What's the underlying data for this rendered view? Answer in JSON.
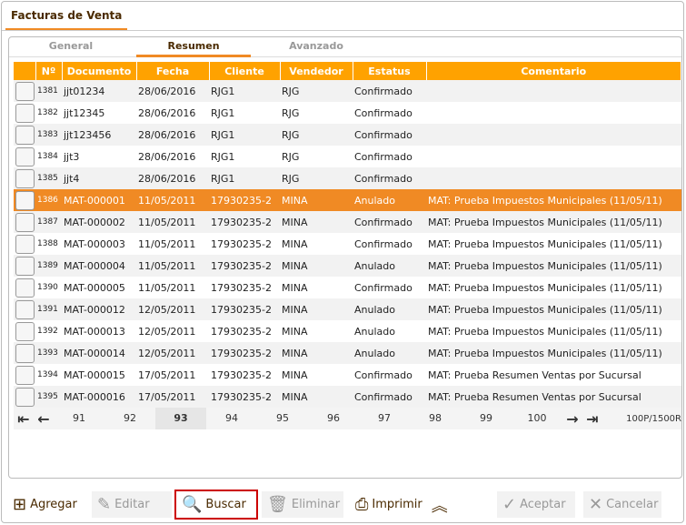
{
  "window": {
    "title": "Facturas de Venta"
  },
  "tabs": [
    "General",
    "Resumen",
    "Avanzado"
  ],
  "columns": [
    "Nº",
    "Documento",
    "Fecha",
    "Cliente",
    "Vendedor",
    "Estatus",
    "Comentario"
  ],
  "rows": [
    [
      "1381",
      "jjt01234",
      "28/06/2016",
      "RJG1",
      "RJG",
      "Confirmado",
      ""
    ],
    [
      "1382",
      "jjt12345",
      "28/06/2016",
      "RJG1",
      "RJG",
      "Confirmado",
      ""
    ],
    [
      "1383",
      "jjt123456",
      "28/06/2016",
      "RJG1",
      "RJG",
      "Confirmado",
      ""
    ],
    [
      "1384",
      "jjt3",
      "28/06/2016",
      "RJG1",
      "RJG",
      "Confirmado",
      ""
    ],
    [
      "1385",
      "jjt4",
      "28/06/2016",
      "RJG1",
      "RJG",
      "Confirmado",
      ""
    ],
    [
      "1386",
      "MAT-000001",
      "11/05/2011",
      "17930235-2",
      "MINA",
      "Anulado",
      "MAT: Prueba Impuestos Municipales (11/05/11)"
    ],
    [
      "1387",
      "MAT-000002",
      "11/05/2011",
      "17930235-2",
      "MINA",
      "Confirmado",
      "MAT: Prueba Impuestos Municipales (11/05/11)"
    ],
    [
      "1388",
      "MAT-000003",
      "11/05/2011",
      "17930235-2",
      "MINA",
      "Confirmado",
      "MAT: Prueba Impuestos Municipales (11/05/11)"
    ],
    [
      "1389",
      "MAT-000004",
      "11/05/2011",
      "17930235-2",
      "MINA",
      "Anulado",
      "MAT: Prueba Impuestos Municipales (11/05/11)"
    ],
    [
      "1390",
      "MAT-000005",
      "11/05/2011",
      "17930235-2",
      "MINA",
      "Confirmado",
      "MAT: Prueba Impuestos Municipales (11/05/11)"
    ],
    [
      "1391",
      "MAT-000012",
      "12/05/2011",
      "17930235-2",
      "MINA",
      "Anulado",
      "MAT: Prueba Impuestos Municipales (11/05/11)"
    ],
    [
      "1392",
      "MAT-000013",
      "12/05/2011",
      "17930235-2",
      "MINA",
      "Anulado",
      "MAT: Prueba Impuestos Municipales (11/05/11)"
    ],
    [
      "1393",
      "MAT-000014",
      "12/05/2011",
      "17930235-2",
      "MINA",
      "Anulado",
      "MAT: Prueba Impuestos Municipales (11/05/11)"
    ],
    [
      "1394",
      "MAT-000015",
      "17/05/2011",
      "17930235-2",
      "MINA",
      "Confirmado",
      "MAT: Prueba Resumen Ventas por Sucursal"
    ],
    [
      "1395",
      "MAT-000016",
      "17/05/2011",
      "17930235-2",
      "MINA",
      "Confirmado",
      "MAT: Prueba Resumen Ventas por Sucursal"
    ]
  ],
  "selected_row": "1386",
  "pager": {
    "pages": [
      "91",
      "92",
      "93",
      "94",
      "95",
      "96",
      "97",
      "98",
      "99",
      "100"
    ],
    "current": "93",
    "total": "100P/1500R"
  },
  "buttons": {
    "add": "Agregar",
    "edit": "Editar",
    "search": "Buscar",
    "delete": "Eliminar",
    "print": "Imprimir",
    "accept": "Aceptar",
    "cancel": "Cancelar"
  }
}
